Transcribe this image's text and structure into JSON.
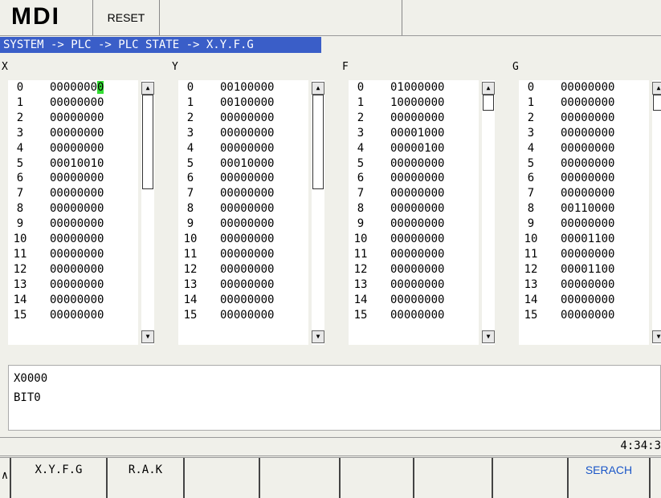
{
  "header": {
    "mode": "MDI",
    "reset_label": "RESET"
  },
  "breadcrumb": "SYSTEM -> PLC -> PLC STATE -> X.Y.F.G",
  "panels": [
    {
      "title": "X",
      "rows": [
        "00000000",
        "00000000",
        "00000000",
        "00000000",
        "00000000",
        "00010010",
        "00000000",
        "00000000",
        "00000000",
        "00000000",
        "00000000",
        "00000000",
        "00000000",
        "00000000",
        "00000000",
        "00000000"
      ]
    },
    {
      "title": "Y",
      "rows": [
        "00100000",
        "00100000",
        "00000000",
        "00000000",
        "00000000",
        "00010000",
        "00000000",
        "00000000",
        "00000000",
        "00000000",
        "00000000",
        "00000000",
        "00000000",
        "00000000",
        "00000000",
        "00000000"
      ]
    },
    {
      "title": "F",
      "rows": [
        "01000000",
        "10000000",
        "00000000",
        "00001000",
        "00000100",
        "00000000",
        "00000000",
        "00000000",
        "00000000",
        "00000000",
        "00000000",
        "00000000",
        "00000000",
        "00000000",
        "00000000",
        "00000000"
      ]
    },
    {
      "title": "G",
      "rows": [
        "00000000",
        "00000000",
        "00000000",
        "00000000",
        "00000000",
        "00000000",
        "00000000",
        "00000000",
        "00110000",
        "00000000",
        "00001100",
        "00000000",
        "00001100",
        "00000000",
        "00000000",
        "00000000"
      ]
    }
  ],
  "indices": [
    "0",
    "1",
    "2",
    "3",
    "4",
    "5",
    "6",
    "7",
    "8",
    "9",
    "10",
    "11",
    "12",
    "13",
    "14",
    "15"
  ],
  "info": {
    "address": "X0000",
    "bit": "BIT0"
  },
  "status": {
    "clock": "4:34:3"
  },
  "softkeys": {
    "up": "∧",
    "xyfg": "X.Y.F.G",
    "rak": "R.A.K",
    "search": "SERACH"
  },
  "colors": {
    "breadcrumb_bg": "#3a5ec8",
    "cursor": "#33dd33",
    "search_text": "#1a56c8"
  }
}
